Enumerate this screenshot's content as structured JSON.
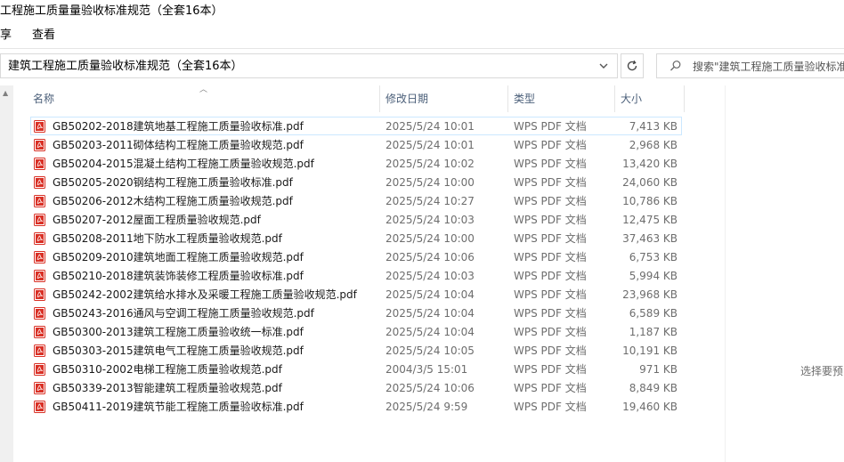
{
  "window": {
    "title": "工程施工质量量验收标准规范（全套16本）"
  },
  "ribbon": {
    "tabs": [
      {
        "label": "享"
      },
      {
        "label": "查看"
      }
    ]
  },
  "address": {
    "path": "建筑工程施工质量验收标准规范（全套16本）"
  },
  "search": {
    "placeholder": "搜索\"建筑工程施工质量验收标准"
  },
  "columns": {
    "name": "名称",
    "date": "修改日期",
    "type": "类型",
    "size": "大小"
  },
  "files": [
    {
      "name": "GB50202-2018建筑地基工程施工质量验收标准.pdf",
      "date": "2025/5/24 10:01",
      "type": "WPS PDF 文档",
      "size": "7,413 KB"
    },
    {
      "name": "GB50203-2011砌体结构工程施工质量验收规范.pdf",
      "date": "2025/5/24 10:01",
      "type": "WPS PDF 文档",
      "size": "2,968 KB"
    },
    {
      "name": "GB50204-2015混凝土结构工程施工质量验收规范.pdf",
      "date": "2025/5/24 10:02",
      "type": "WPS PDF 文档",
      "size": "13,420 KB"
    },
    {
      "name": "GB50205-2020钢结构工程施工质量验收标准.pdf",
      "date": "2025/5/24 10:00",
      "type": "WPS PDF 文档",
      "size": "24,060 KB"
    },
    {
      "name": "GB50206-2012木结构工程施工质量验收规范.pdf",
      "date": "2025/5/24 10:27",
      "type": "WPS PDF 文档",
      "size": "10,786 KB"
    },
    {
      "name": "GB50207-2012屋面工程质量验收规范.pdf",
      "date": "2025/5/24 10:03",
      "type": "WPS PDF 文档",
      "size": "12,475 KB"
    },
    {
      "name": "GB50208-2011地下防水工程质量验收规范.pdf",
      "date": "2025/5/24 10:00",
      "type": "WPS PDF 文档",
      "size": "37,463 KB"
    },
    {
      "name": "GB50209-2010建筑地面工程施工质量验收规范.pdf",
      "date": "2025/5/24 10:06",
      "type": "WPS PDF 文档",
      "size": "6,753 KB"
    },
    {
      "name": "GB50210-2018建筑装饰装修工程质量验收标准.pdf",
      "date": "2025/5/24 10:03",
      "type": "WPS PDF 文档",
      "size": "5,994 KB"
    },
    {
      "name": "GB50242-2002建筑给水排水及采暖工程施工质量验收规范.pdf",
      "date": "2025/5/24 10:04",
      "type": "WPS PDF 文档",
      "size": "23,968 KB"
    },
    {
      "name": "GB50243-2016通风与空调工程施工质量验收规范.pdf",
      "date": "2025/5/24 10:04",
      "type": "WPS PDF 文档",
      "size": "6,589 KB"
    },
    {
      "name": "GB50300-2013建筑工程施工质量验收统一标准.pdf",
      "date": "2025/5/24 10:04",
      "type": "WPS PDF 文档",
      "size": "1,187 KB"
    },
    {
      "name": "GB50303-2015建筑电气工程施工质量验收规范.pdf",
      "date": "2025/5/24 10:05",
      "type": "WPS PDF 文档",
      "size": "10,191 KB"
    },
    {
      "name": "GB50310-2002电梯工程施工质量验收规范.pdf",
      "date": "2004/3/5 15:01",
      "type": "WPS PDF 文档",
      "size": "971 KB"
    },
    {
      "name": "GB50339-2013智能建筑工程质量验收规范.pdf",
      "date": "2025/5/24 10:06",
      "type": "WPS PDF 文档",
      "size": "8,849 KB"
    },
    {
      "name": "GB50411-2019建筑节能工程施工质量验收标准.pdf",
      "date": "2025/5/24 9:59",
      "type": "WPS PDF 文档",
      "size": "19,460 KB"
    }
  ],
  "preview": {
    "hint": "选择要预"
  },
  "colors": {
    "pdf_icon": "#d93025",
    "selection_border": "#cce8ff",
    "header_text": "#4c607a"
  },
  "icons": {
    "file": "pdf-file-icon",
    "address_dropdown": "chevron-down-icon",
    "refresh": "refresh-icon",
    "search": "search-icon",
    "sort": "sort-up-icon"
  }
}
